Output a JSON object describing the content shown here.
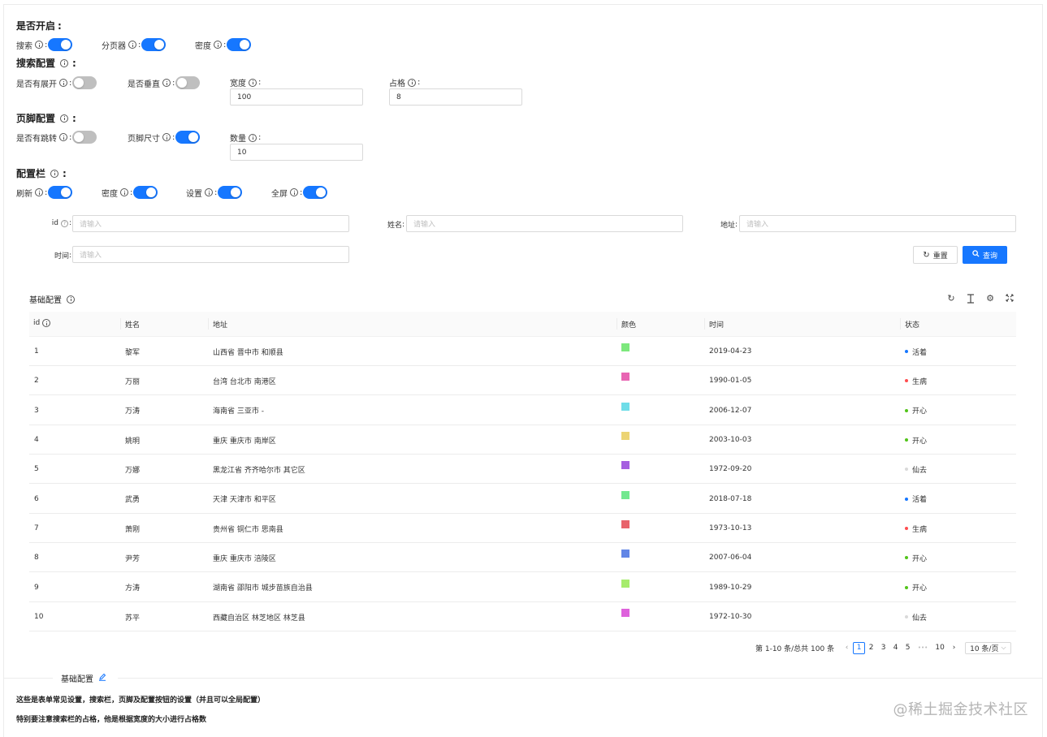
{
  "config": {
    "enable": {
      "title": "是否开启",
      "items": [
        {
          "label": "搜索",
          "on": true
        },
        {
          "label": "分页器",
          "on": true
        },
        {
          "label": "密度",
          "on": true
        }
      ]
    },
    "search": {
      "title": "搜索配置",
      "expand_label": "是否有展开",
      "vertical_label": "是否垂直",
      "width_label": "宽度",
      "width_value": "100",
      "span_label": "占格",
      "span_value": "8"
    },
    "footer": {
      "title": "页脚配置",
      "jump_label": "是否有跳转",
      "size_label": "页脚尺寸",
      "count_label": "数量",
      "count_value": "10"
    },
    "toolbar": {
      "title": "配置栏",
      "items": [
        {
          "label": "刷新",
          "on": true
        },
        {
          "label": "密度",
          "on": true
        },
        {
          "label": "设置",
          "on": true
        },
        {
          "label": "全屏",
          "on": true
        }
      ]
    }
  },
  "search_form": {
    "id_label": "id",
    "name_label": "姓名",
    "address_label": "地址",
    "time_label": "时间",
    "placeholder": "请输入",
    "reset_label": "重置",
    "query_label": "查询"
  },
  "table": {
    "title": "基础配置",
    "columns": [
      "id",
      "姓名",
      "地址",
      "颜色",
      "时间",
      "状态"
    ],
    "rows": [
      {
        "id": "1",
        "name": "黎军",
        "address": "山西省 晋中市 和顺县",
        "color": "#7de87d",
        "time": "2019-04-23",
        "status": "活着",
        "status_color": "#1677ff"
      },
      {
        "id": "2",
        "name": "万丽",
        "address": "台湾 台北市 南港区",
        "color": "#e865b3",
        "time": "1990-01-05",
        "status": "生病",
        "status_color": "#ff4d4f"
      },
      {
        "id": "3",
        "name": "万涛",
        "address": "海南省 三亚市 -",
        "color": "#6fdde8",
        "time": "2006-12-07",
        "status": "开心",
        "status_color": "#52c41a"
      },
      {
        "id": "4",
        "name": "姚明",
        "address": "重庆 重庆市 南岸区",
        "color": "#ecd474",
        "time": "2003-10-03",
        "status": "开心",
        "status_color": "#52c41a"
      },
      {
        "id": "5",
        "name": "万娜",
        "address": "黑龙江省 齐齐哈尔市 其它区",
        "color": "#a55fe0",
        "time": "1972-09-20",
        "status": "仙去",
        "status_color": "#d9d9d9"
      },
      {
        "id": "6",
        "name": "武勇",
        "address": "天津 天津市 和平区",
        "color": "#72e88f",
        "time": "2018-07-18",
        "status": "活着",
        "status_color": "#1677ff"
      },
      {
        "id": "7",
        "name": "萧刚",
        "address": "贵州省 铜仁市 思南县",
        "color": "#e8636b",
        "time": "1973-10-13",
        "status": "生病",
        "status_color": "#ff4d4f"
      },
      {
        "id": "8",
        "name": "尹芳",
        "address": "重庆 重庆市 涪陵区",
        "color": "#6286e6",
        "time": "2007-06-04",
        "status": "开心",
        "status_color": "#52c41a"
      },
      {
        "id": "9",
        "name": "方涛",
        "address": "湖南省 邵阳市 城步苗族自治县",
        "color": "#a6ec6c",
        "time": "1989-10-29",
        "status": "开心",
        "status_color": "#52c41a"
      },
      {
        "id": "10",
        "name": "苏平",
        "address": "西藏自治区 林芝地区 林芝县",
        "color": "#de62dc",
        "time": "1972-10-30",
        "status": "仙去",
        "status_color": "#d9d9d9"
      }
    ]
  },
  "pagination": {
    "summary": "第 1-10 条/总共 100 条",
    "pages": [
      "1",
      "2",
      "3",
      "4",
      "5"
    ],
    "ellipsis": "•••",
    "last_page": "10",
    "current": "1",
    "page_size": "10 条/页"
  },
  "description": {
    "title": "基础配置",
    "line1": "这些是表单常见设置，搜索栏，页脚及配置按钮的设置（并且可以全局配置）",
    "line2": "特别要注意搜索栏的占格，他是根据宽度的大小进行占格数"
  },
  "watermark": "@稀土掘金技术社区",
  "colors": {
    "primary": "#1677ff",
    "switch_off": "#bfbfbf"
  }
}
